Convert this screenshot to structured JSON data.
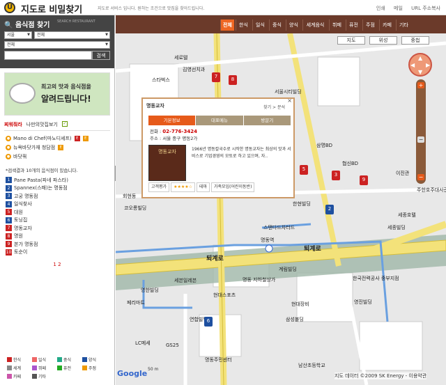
{
  "header": {
    "logo_letter": "U",
    "brand": "지도로 비밀찾기",
    "tagline": "지도로 서비스 입니다. 원하는 조건으로 맛집을 찾아드립니다.",
    "links": [
      "인쇄",
      "메일",
      "URL 주소복사"
    ]
  },
  "sidebar": {
    "title": "음식점 찾기",
    "subtitle_en": "SEARCH RESTAURANT",
    "region1": "서울",
    "region2": "전체",
    "category": "전체",
    "search_button": "검색",
    "banner": {
      "line1": "최고의 맛과 음식점을",
      "line2": "알려드립니다!",
      "cup": "Nul 맛집 클럽"
    },
    "tabs": {
      "fav": "찌워줘라",
      "mine": "나만의맛집보기",
      "check": "✓"
    },
    "favorites": [
      {
        "name": "Mano di Chef(마노디셰프)",
        "badges": [
          "E",
          "E"
        ]
      },
      {
        "name": "뉴욕바닷가재 청담점",
        "badges": [
          "E"
        ]
      },
      {
        "name": "바닷꿔",
        "badges": []
      }
    ],
    "count_text": "*검색결과 10개의 음식점이 있습니다.",
    "results": [
      {
        "n": "1",
        "name": "Pane Pasta(파네 파스타)",
        "color": "#1e50a0"
      },
      {
        "n": "2",
        "name": "Spannex(스패)는 명동점",
        "color": "#1e50a0"
      },
      {
        "n": "3",
        "name": "고궁 명동점",
        "color": "#1e50a0"
      },
      {
        "n": "4",
        "name": "일식찾사",
        "color": "#1e50a0"
      },
      {
        "n": "5",
        "name": "대원",
        "color": "#c22"
      },
      {
        "n": "6",
        "name": "토닝집",
        "color": "#1e50a0"
      },
      {
        "n": "7",
        "name": "명동교자",
        "color": "#c22"
      },
      {
        "n": "8",
        "name": "명원",
        "color": "#c22"
      },
      {
        "n": "9",
        "name": "본가 명동점",
        "color": "#c22"
      },
      {
        "n": "10",
        "name": "토순이",
        "color": "#c22"
      }
    ],
    "pager": "1 2",
    "legend": [
      {
        "label": "한식",
        "color": "#c22"
      },
      {
        "label": "일식",
        "color": "#e66"
      },
      {
        "label": "중식",
        "color": "#2a8"
      },
      {
        "label": "양식",
        "color": "#1e50a0"
      },
      {
        "label": "세계",
        "color": "#888"
      },
      {
        "label": "뷔페",
        "color": "#a5c"
      },
      {
        "label": "퓨전",
        "color": "#2a2"
      },
      {
        "label": "주점",
        "color": "#e90"
      },
      {
        "label": "카페",
        "color": "#c5a"
      },
      {
        "label": "기타",
        "color": "#555"
      }
    ]
  },
  "map": {
    "categories": [
      "전체",
      "한식",
      "일식",
      "중식",
      "양식",
      "세계음식",
      "뷔페",
      "퓨전",
      "주점",
      "카페",
      "기타"
    ],
    "view_types": [
      "지도",
      "위성",
      "중첩"
    ],
    "labels": [
      "김영선치과",
      "스타벅스",
      "서울시티빌딩",
      "삼명BD",
      "협신BD",
      "이진관",
      "주한호주대사관",
      "세종호텔",
      "명동역",
      "퇴계로",
      "회현동",
      "스탠다드차터드",
      "계림빌딩",
      "한국전력공사 중부지점",
      "한현빌딩",
      "세종빌딩",
      "영진빌딩",
      "명동 지하철상가",
      "세븐일레븐",
      "현대스포츠",
      "영한빌딩",
      "현대장비",
      "삼성블딩",
      "페리마트",
      "연합빌딩",
      "LC메세",
      "GS25",
      "명동주민센터",
      "남산초등학교",
      "세븐일레븐",
      "세로텔",
      "코오롱빌딩"
    ],
    "copyright": "지도 데이터 ©2009 SK Energy - 이용약관",
    "scale": "50 m",
    "google": "Google"
  },
  "popup": {
    "name": "명동교자",
    "links": "찾기 > 분석",
    "tabs": [
      "기본정보",
      "대표메뉴",
      "방문기"
    ],
    "phone_label": "전화 :",
    "phone": "02-776-3424",
    "addr": "주소 : 서울 중구 명동2가",
    "desc": "1966년 명동칼국수로 시작한 명동교자는 최상의 맛과 서비스로 기업경영의 모토로 하고 있으며, 자..",
    "rating_label": "고객평가",
    "stars": "★★★★☆",
    "theme": "테마",
    "theme_value": "가족모임(어린이동반)",
    "img_caption": "명동교자"
  },
  "markers": [
    {
      "n": "7",
      "color": "#c22"
    },
    {
      "n": "8",
      "color": "#c22"
    },
    {
      "n": "5",
      "color": "#c22"
    },
    {
      "n": "3",
      "color": "#c22"
    },
    {
      "n": "9",
      "color": "#c22"
    },
    {
      "n": "2",
      "color": "#1e50a0"
    },
    {
      "n": "6",
      "color": "#1e50a0"
    }
  ]
}
